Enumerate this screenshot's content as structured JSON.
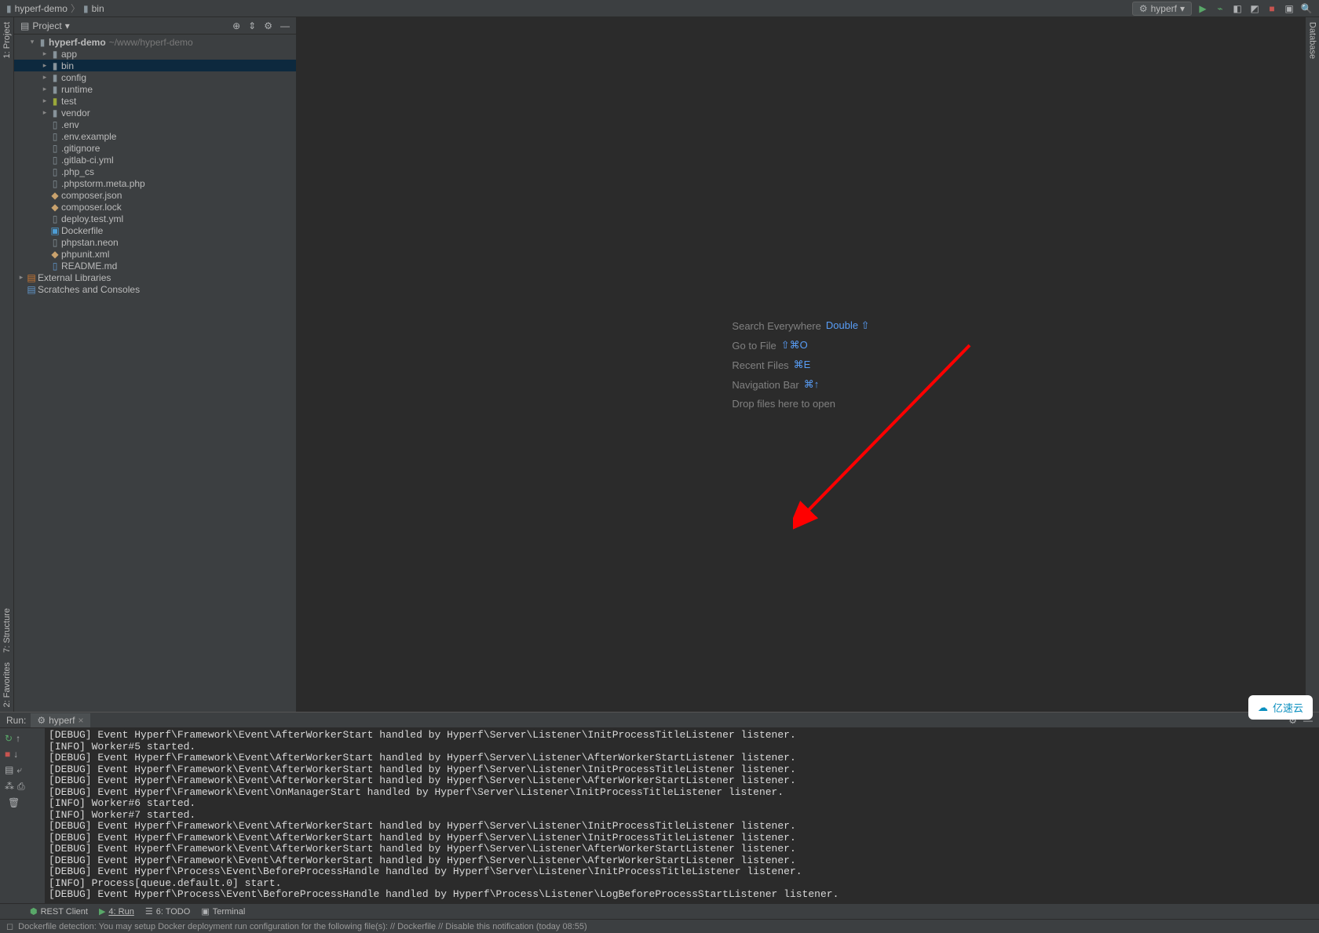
{
  "breadcrumb": {
    "root": "hyperf-demo",
    "child": "bin"
  },
  "titlebar": {
    "runConfig": "hyperf",
    "icons": [
      "play",
      "bug",
      "coverage",
      "profiler",
      "stop",
      "layout",
      "search"
    ]
  },
  "leftGutter": {
    "project": "1: Project"
  },
  "rightGutter": {
    "database": "Database"
  },
  "projectPanel": {
    "title": "Project",
    "tree": {
      "root": {
        "name": "hyperf-demo",
        "path": "~/www/hyperf-demo"
      },
      "dirs": [
        "app",
        "bin",
        "config",
        "runtime",
        "test",
        "vendor"
      ],
      "files": [
        ".env",
        ".env.example",
        ".gitignore",
        ".gitlab-ci.yml",
        ".php_cs",
        ".phpstorm.meta.php",
        "composer.json",
        "composer.lock",
        "deploy.test.yml",
        "Dockerfile",
        "phpstan.neon",
        "phpunit.xml",
        "README.md"
      ],
      "external": "External Libraries",
      "scratches": "Scratches and Consoles"
    }
  },
  "editorHints": {
    "searchEverywhere": {
      "label": "Search Everywhere",
      "shortcut": "Double ⇧"
    },
    "gotoFile": {
      "label": "Go to File",
      "shortcut": "⇧⌘O"
    },
    "recentFiles": {
      "label": "Recent Files",
      "shortcut": "⌘E"
    },
    "navBar": {
      "label": "Navigation Bar",
      "shortcut": "⌘↑"
    },
    "dropFiles": {
      "label": "Drop files here to open"
    }
  },
  "runPanel": {
    "title": "Run:",
    "tab": "hyperf",
    "console": [
      "[DEBUG] Event Hyperf\\Framework\\Event\\AfterWorkerStart handled by Hyperf\\Server\\Listener\\InitProcessTitleListener listener.",
      "[INFO] Worker#5 started.",
      "[DEBUG] Event Hyperf\\Framework\\Event\\AfterWorkerStart handled by Hyperf\\Server\\Listener\\AfterWorkerStartListener listener.",
      "[DEBUG] Event Hyperf\\Framework\\Event\\AfterWorkerStart handled by Hyperf\\Server\\Listener\\InitProcessTitleListener listener.",
      "[DEBUG] Event Hyperf\\Framework\\Event\\AfterWorkerStart handled by Hyperf\\Server\\Listener\\AfterWorkerStartListener listener.",
      "[DEBUG] Event Hyperf\\Framework\\Event\\OnManagerStart handled by Hyperf\\Server\\Listener\\InitProcessTitleListener listener.",
      "[INFO] Worker#6 started.",
      "[INFO] Worker#7 started.",
      "[DEBUG] Event Hyperf\\Framework\\Event\\AfterWorkerStart handled by Hyperf\\Server\\Listener\\InitProcessTitleListener listener.",
      "[DEBUG] Event Hyperf\\Framework\\Event\\AfterWorkerStart handled by Hyperf\\Server\\Listener\\InitProcessTitleListener listener.",
      "[DEBUG] Event Hyperf\\Framework\\Event\\AfterWorkerStart handled by Hyperf\\Server\\Listener\\AfterWorkerStartListener listener.",
      "[DEBUG] Event Hyperf\\Framework\\Event\\AfterWorkerStart handled by Hyperf\\Server\\Listener\\AfterWorkerStartListener listener.",
      "[DEBUG] Event Hyperf\\Process\\Event\\BeforeProcessHandle handled by Hyperf\\Server\\Listener\\InitProcessTitleListener listener.",
      "[INFO] Process[queue.default.0] start.",
      "[DEBUG] Event Hyperf\\Process\\Event\\BeforeProcessHandle handled by Hyperf\\Process\\Listener\\LogBeforeProcessStartListener listener."
    ]
  },
  "bottomTabs": {
    "rest": "REST Client",
    "run": "4: Run",
    "todo": "6: TODO",
    "terminal": "Terminal"
  },
  "leftBottomGutter": {
    "structure": "7: Structure",
    "favorites": "2: Favorites"
  },
  "statusBar": {
    "message": "Dockerfile detection: You may setup Docker deployment run configuration for the following file(s): // Dockerfile // Disable this notification (today 08:55)"
  },
  "watermark": "亿速云"
}
